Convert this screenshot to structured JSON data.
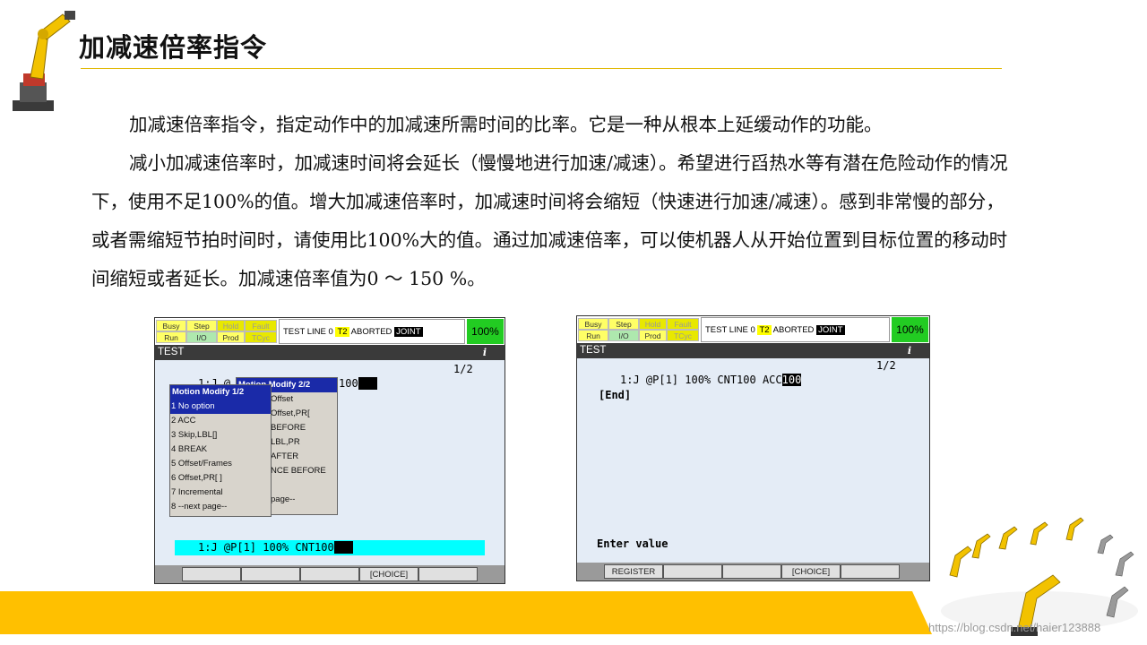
{
  "title": "加减速倍率指令",
  "paragraphs": [
    "加减速倍率指令，指定动作中的加减速所需时间的比率。它是一种从根本上延缓动作的功能。",
    "减小加减速倍率时，加减速时间将会延长（慢慢地进行加速/减速）。希望进行舀热水等有潜在危险动作的情况下，使用不足100%的值。增大加减速倍率时，加减速时间将会缩短（快速进行加速/减速）。感到非常慢的部分，或者需缩短节拍时间时，请使用比100%大的值。通过加减速倍率，可以使机器人从开始位置到目标位置的移动时间缩短或者延长。加减速倍率值为0 ～ 150 %。"
  ],
  "watermark": "https://blog.csdn.net/haier123888",
  "colors": {
    "band": "#ffc000",
    "rule": "#e0b800",
    "menu_header": "#1a2aa8",
    "status_green": "#22cc22"
  },
  "status_labels": {
    "busy": "Busy",
    "step": "Step",
    "hold": "Hold",
    "fault": "Fault",
    "run": "Run",
    "io": "I/O",
    "prod": "Prod",
    "tcyc": "TCyc"
  },
  "status_line": {
    "prefix": "TEST LINE 0",
    "mode": "T2",
    "state": "ABORTED",
    "coord": "JOINT"
  },
  "screen1": {
    "override": "100%",
    "program": "TEST",
    "page": "1/2",
    "line_partial": "1:J @",
    "line_tail": "100",
    "menu_back": {
      "header": "Motion Modify  2/2",
      "items": [
        "Offset",
        "Offset,PR[",
        "BEFORE",
        "LBL,PR",
        "AFTER",
        "NCE BEFORE",
        "",
        "page--"
      ]
    },
    "menu_front": {
      "header": "Motion Modify  1/2",
      "items": [
        "1 No option",
        "2 ACC",
        "3 Skip,LBL[]",
        "4 BREAK",
        "5 Offset/Frames",
        "6 Offset,PR[  ]",
        "7 Incremental",
        "8 --next page--"
      ]
    },
    "edit_line": "1:J @P[1] 100% CNT100",
    "fkeys": [
      "",
      "",
      "",
      "[CHOICE]",
      ""
    ]
  },
  "screen2": {
    "override": "100%",
    "program": "TEST",
    "page": "1/2",
    "line1": "1:J @P[1] 100% CNT100 ACC",
    "line1_value": "100",
    "end": "[End]",
    "prompt": "Enter value",
    "fkeys": [
      "REGISTER",
      "",
      "",
      "[CHOICE]",
      ""
    ]
  }
}
